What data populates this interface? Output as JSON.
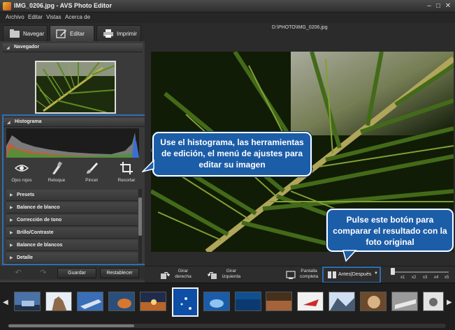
{
  "window": {
    "title": "IMG_0206.jpg - AVS Photo Editor"
  },
  "menu": [
    "Archivo",
    "Editar",
    "Vistas",
    "Acerca de"
  ],
  "tabs": [
    {
      "label": "Navegar",
      "active": false
    },
    {
      "label": "Editar",
      "active": true
    },
    {
      "label": "Imprimir",
      "active": false
    }
  ],
  "navigator": {
    "title": "Navegador"
  },
  "histogram": {
    "title": "Histograma"
  },
  "tools": [
    "Ojos rojos",
    "Retoque",
    "Pincel",
    "Recortar"
  ],
  "adjustments": [
    "Presets",
    "Balance de blanco",
    "Corrección de tono",
    "Brillo/Contraste",
    "Balance de blancos",
    "Detalle"
  ],
  "actions": {
    "save": "Guardar",
    "reset": "Restablecer"
  },
  "file_path": "D:\\PHOTO\\IMG_0206.jpg",
  "callouts": {
    "histogram": "Use el histograma, las herramientas de edición, el menú de ajustes para editar su imagen",
    "compare": "Pulse este botón para comparar el resultado con la foto original"
  },
  "toolbar": {
    "rotate_right": "Girar derecha",
    "rotate_left": "Girar izquierda",
    "fullscreen": "Pantalla completa",
    "before_after": "Antes|Después",
    "zoom_labels": [
      "x1",
      "x2",
      "x3",
      "x4",
      "x5"
    ]
  },
  "colors": {
    "accent": "#2d6fb5",
    "callout_bg": "#1c5da8"
  }
}
